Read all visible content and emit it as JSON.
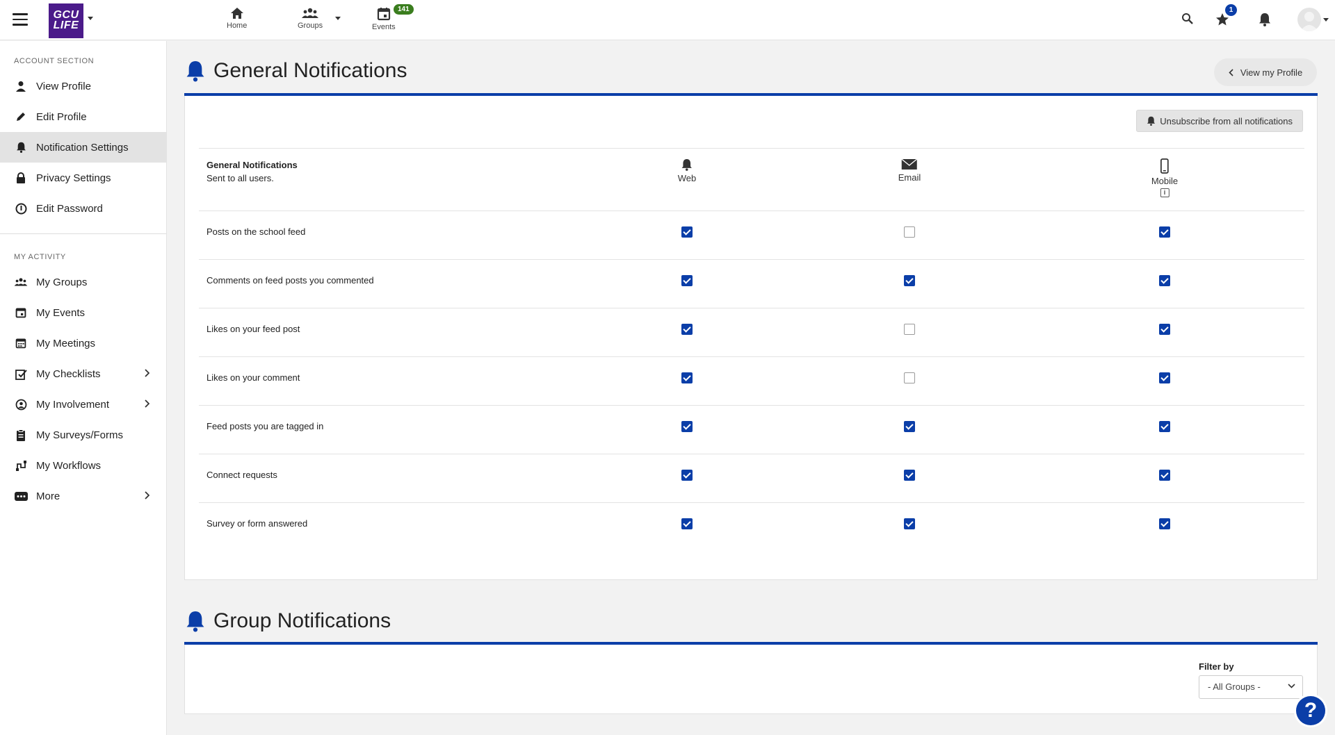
{
  "header": {
    "logo_text": "GCU LIFE",
    "nav": [
      {
        "label": "Home"
      },
      {
        "label": "Groups"
      },
      {
        "label": "Events"
      }
    ],
    "events_badge": "141",
    "favorites_badge": "1"
  },
  "sidebar": {
    "account_section_title": "ACCOUNT SECTION",
    "account_items": [
      {
        "label": "View Profile",
        "icon": "person-icon"
      },
      {
        "label": "Edit Profile",
        "icon": "pencil-icon"
      },
      {
        "label": "Notification Settings",
        "icon": "bell-icon",
        "active": true
      },
      {
        "label": "Privacy Settings",
        "icon": "lock-icon"
      },
      {
        "label": "Edit Password",
        "icon": "key-icon"
      }
    ],
    "activity_section_title": "MY ACTIVITY",
    "activity_items": [
      {
        "label": "My Groups",
        "icon": "groups-icon"
      },
      {
        "label": "My Events",
        "icon": "calendar-icon"
      },
      {
        "label": "My Meetings",
        "icon": "meetings-icon"
      },
      {
        "label": "My Checklists",
        "icon": "checklist-icon",
        "has_submenu": true
      },
      {
        "label": "My Involvement",
        "icon": "involvement-icon",
        "has_submenu": true
      },
      {
        "label": "My Surveys/Forms",
        "icon": "clipboard-icon"
      },
      {
        "label": "My Workflows",
        "icon": "workflow-icon"
      },
      {
        "label": "More",
        "icon": "more-icon",
        "has_submenu": true
      }
    ]
  },
  "general": {
    "title": "General Notifications",
    "view_profile_label": "View my Profile",
    "unsubscribe_label": "Unsubscribe from all notifications",
    "table_title": "General Notifications",
    "table_subtitle": "Sent to all users.",
    "columns": [
      "Web",
      "Email",
      "Mobile"
    ],
    "rows": [
      {
        "label": "Posts on the school feed",
        "web": true,
        "email": false,
        "mobile": true
      },
      {
        "label": "Comments on feed posts you commented",
        "web": true,
        "email": true,
        "mobile": true
      },
      {
        "label": "Likes on your feed post",
        "web": true,
        "email": false,
        "mobile": true
      },
      {
        "label": "Likes on your comment",
        "web": true,
        "email": false,
        "mobile": true
      },
      {
        "label": "Feed posts you are tagged in",
        "web": true,
        "email": true,
        "mobile": true
      },
      {
        "label": "Connect requests",
        "web": true,
        "email": true,
        "mobile": true
      },
      {
        "label": "Survey or form answered",
        "web": true,
        "email": true,
        "mobile": true
      }
    ]
  },
  "group": {
    "title": "Group Notifications",
    "filter_label": "Filter by",
    "filter_value": "- All Groups -"
  },
  "help_label": "?",
  "colors": {
    "accent": "#0b3ea8",
    "logo_bg": "#4b1b8a",
    "badge_green": "#3a7d1e"
  }
}
